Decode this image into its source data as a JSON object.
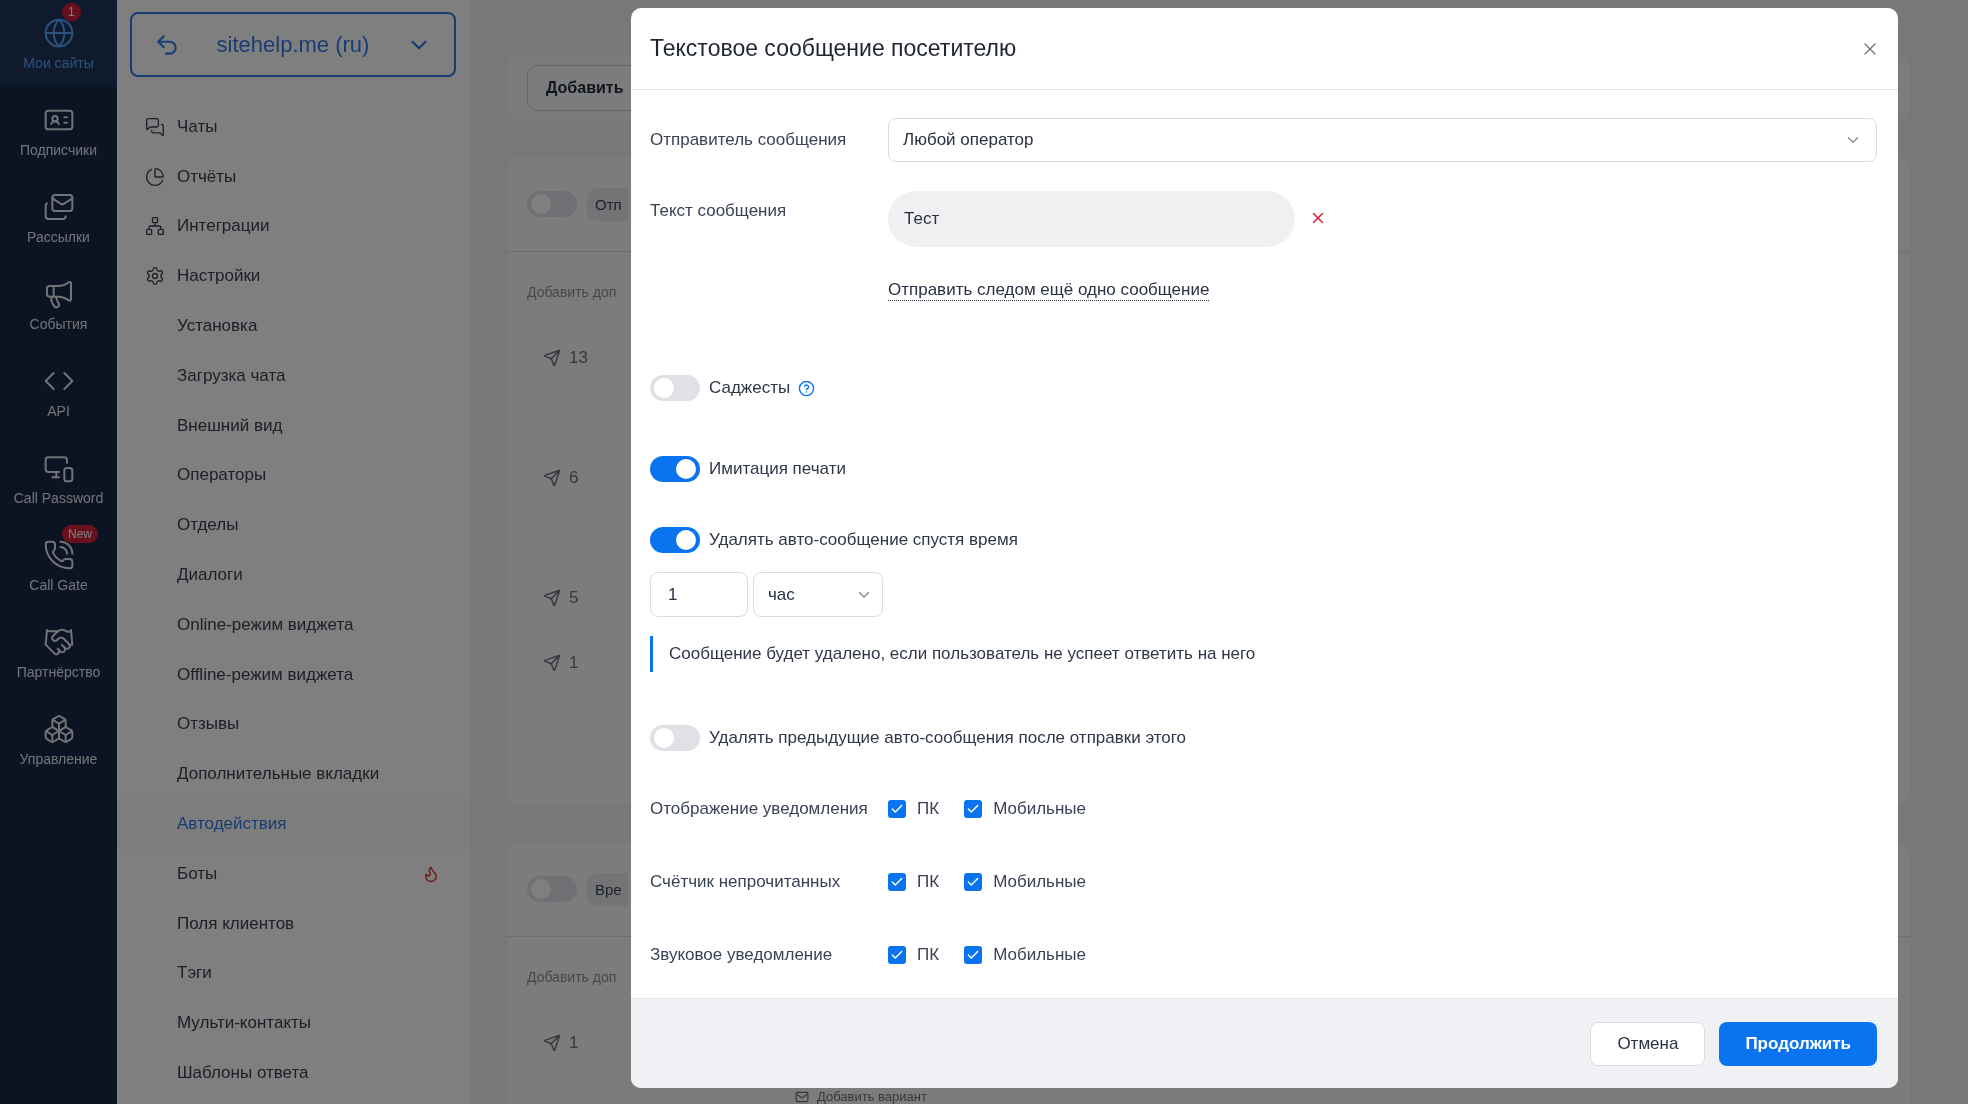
{
  "rail": [
    {
      "label": "Мои сайты",
      "selected": true,
      "badge": "1"
    },
    {
      "label": "Подписчики",
      "selected": false
    },
    {
      "label": "Рассылки",
      "selected": false
    },
    {
      "label": "События",
      "selected": false
    },
    {
      "label": "API",
      "selected": false
    },
    {
      "label": "Call Password",
      "selected": false
    },
    {
      "label": "Call Gate",
      "selected": false,
      "badge": "New"
    },
    {
      "label": "Партнёрство",
      "selected": false
    },
    {
      "label": "Управление",
      "selected": false
    }
  ],
  "site_selector": {
    "label": "sitehelp.me (ru)"
  },
  "nav": [
    {
      "label": "Чаты",
      "kind": "section",
      "selected": false,
      "hot": false
    },
    {
      "label": "Отчёты",
      "kind": "section",
      "selected": false,
      "hot": false
    },
    {
      "label": "Интеграции",
      "kind": "section",
      "selected": false,
      "hot": false
    },
    {
      "label": "Настройки",
      "kind": "section",
      "selected": false,
      "hot": false
    },
    {
      "label": "Установка",
      "kind": "page",
      "selected": false,
      "hot": false
    },
    {
      "label": "Загрузка чата",
      "kind": "page",
      "selected": false,
      "hot": false
    },
    {
      "label": "Внешний вид",
      "kind": "page",
      "selected": false,
      "hot": false
    },
    {
      "label": "Операторы",
      "kind": "page",
      "selected": false,
      "hot": false
    },
    {
      "label": "Отделы",
      "kind": "page",
      "selected": false,
      "hot": false
    },
    {
      "label": "Диалоги",
      "kind": "page",
      "selected": false,
      "hot": false
    },
    {
      "label": "Online-режим виджета",
      "kind": "page",
      "selected": false,
      "hot": false
    },
    {
      "label": "Offline-режим виджета",
      "kind": "page",
      "selected": false,
      "hot": false
    },
    {
      "label": "Отзывы",
      "kind": "page",
      "selected": false,
      "hot": false
    },
    {
      "label": "Дополнительные вкладки",
      "kind": "page",
      "selected": false,
      "hot": false
    },
    {
      "label": "Автодействия",
      "kind": "page",
      "selected": true,
      "hot": false
    },
    {
      "label": "Боты",
      "kind": "page",
      "selected": false,
      "hot": true
    },
    {
      "label": "Поля клиентов",
      "kind": "page",
      "selected": false,
      "hot": false
    },
    {
      "label": "Тэги",
      "kind": "page",
      "selected": false,
      "hot": false
    },
    {
      "label": "Мульти-контакты",
      "kind": "page",
      "selected": false,
      "hot": false
    },
    {
      "label": "Шаблоны ответа",
      "kind": "page",
      "selected": false,
      "hot": false
    }
  ],
  "background": {
    "add_button": "Добавить",
    "cards": [
      {
        "on": false,
        "chip": "Отп",
        "hint": "Добавить доп",
        "counts": [
          "13",
          "6",
          "5",
          "1"
        ]
      },
      {
        "on": false,
        "chip": "Вре",
        "hint": "Добавить доп",
        "counts": [
          "1"
        ]
      }
    ],
    "bottom_link": "Добавить вариант"
  },
  "modal": {
    "title": "Текстовое сообщение посетителю",
    "sender": {
      "label": "Отправитель сообщения",
      "value": "Любой оператор"
    },
    "message": {
      "label": "Текст сообщения",
      "value": "Тест"
    },
    "add_link": "Отправить следом ещё одно сообщение",
    "settings": [
      {
        "kind": "toggle",
        "label": "Саджесты",
        "on": false,
        "help": true
      },
      {
        "kind": "toggle",
        "label": "Имитация печати",
        "on": true,
        "help": false
      },
      {
        "kind": "toggle",
        "label": "Удалять авто-сообщение спустя время",
        "on": true,
        "help": false
      },
      {
        "kind": "delay",
        "value": "1",
        "unit": "час"
      },
      {
        "kind": "note",
        "text": "Сообщение будет удалено, если пользователь не успеет ответить на него"
      },
      {
        "kind": "toggle",
        "label": "Удалять предыдущие авто-сообщения после отправки этого",
        "on": false,
        "help": false
      }
    ],
    "notifications": [
      {
        "label": "Отображение уведомления",
        "options": [
          {
            "label": "ПК",
            "checked": true
          },
          {
            "label": "Мобильные",
            "checked": true
          }
        ]
      },
      {
        "label": "Счётчик непрочитанных",
        "options": [
          {
            "label": "ПК",
            "checked": true
          },
          {
            "label": "Мобильные",
            "checked": true
          }
        ]
      },
      {
        "label": "Звуковое уведомление",
        "options": [
          {
            "label": "ПК",
            "checked": true
          },
          {
            "label": "Мобильные",
            "checked": true
          }
        ]
      }
    ],
    "buttons": [
      {
        "label": "Отмена",
        "kind": "secondary"
      },
      {
        "label": "Продолжить",
        "kind": "primary"
      }
    ]
  }
}
